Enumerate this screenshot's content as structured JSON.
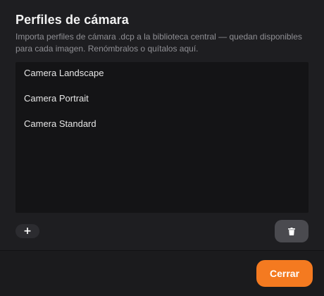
{
  "dialog": {
    "title": "Perfiles de cámara",
    "description": "Importa perfiles de cámara .dcp a la biblioteca central — quedan disponibles para cada imagen. Renómbralos o quítalos aquí."
  },
  "profiles": [
    {
      "label": "Camera Landscape"
    },
    {
      "label": "Camera Portrait"
    },
    {
      "label": "Camera Standard"
    }
  ],
  "actions": {
    "add_label": "+",
    "add_icon": "plus-icon",
    "delete_icon": "trash-icon",
    "close_label": "Cerrar"
  },
  "colors": {
    "accent": "#f47a20",
    "background": "#1e1e21",
    "list_background": "#141416"
  }
}
